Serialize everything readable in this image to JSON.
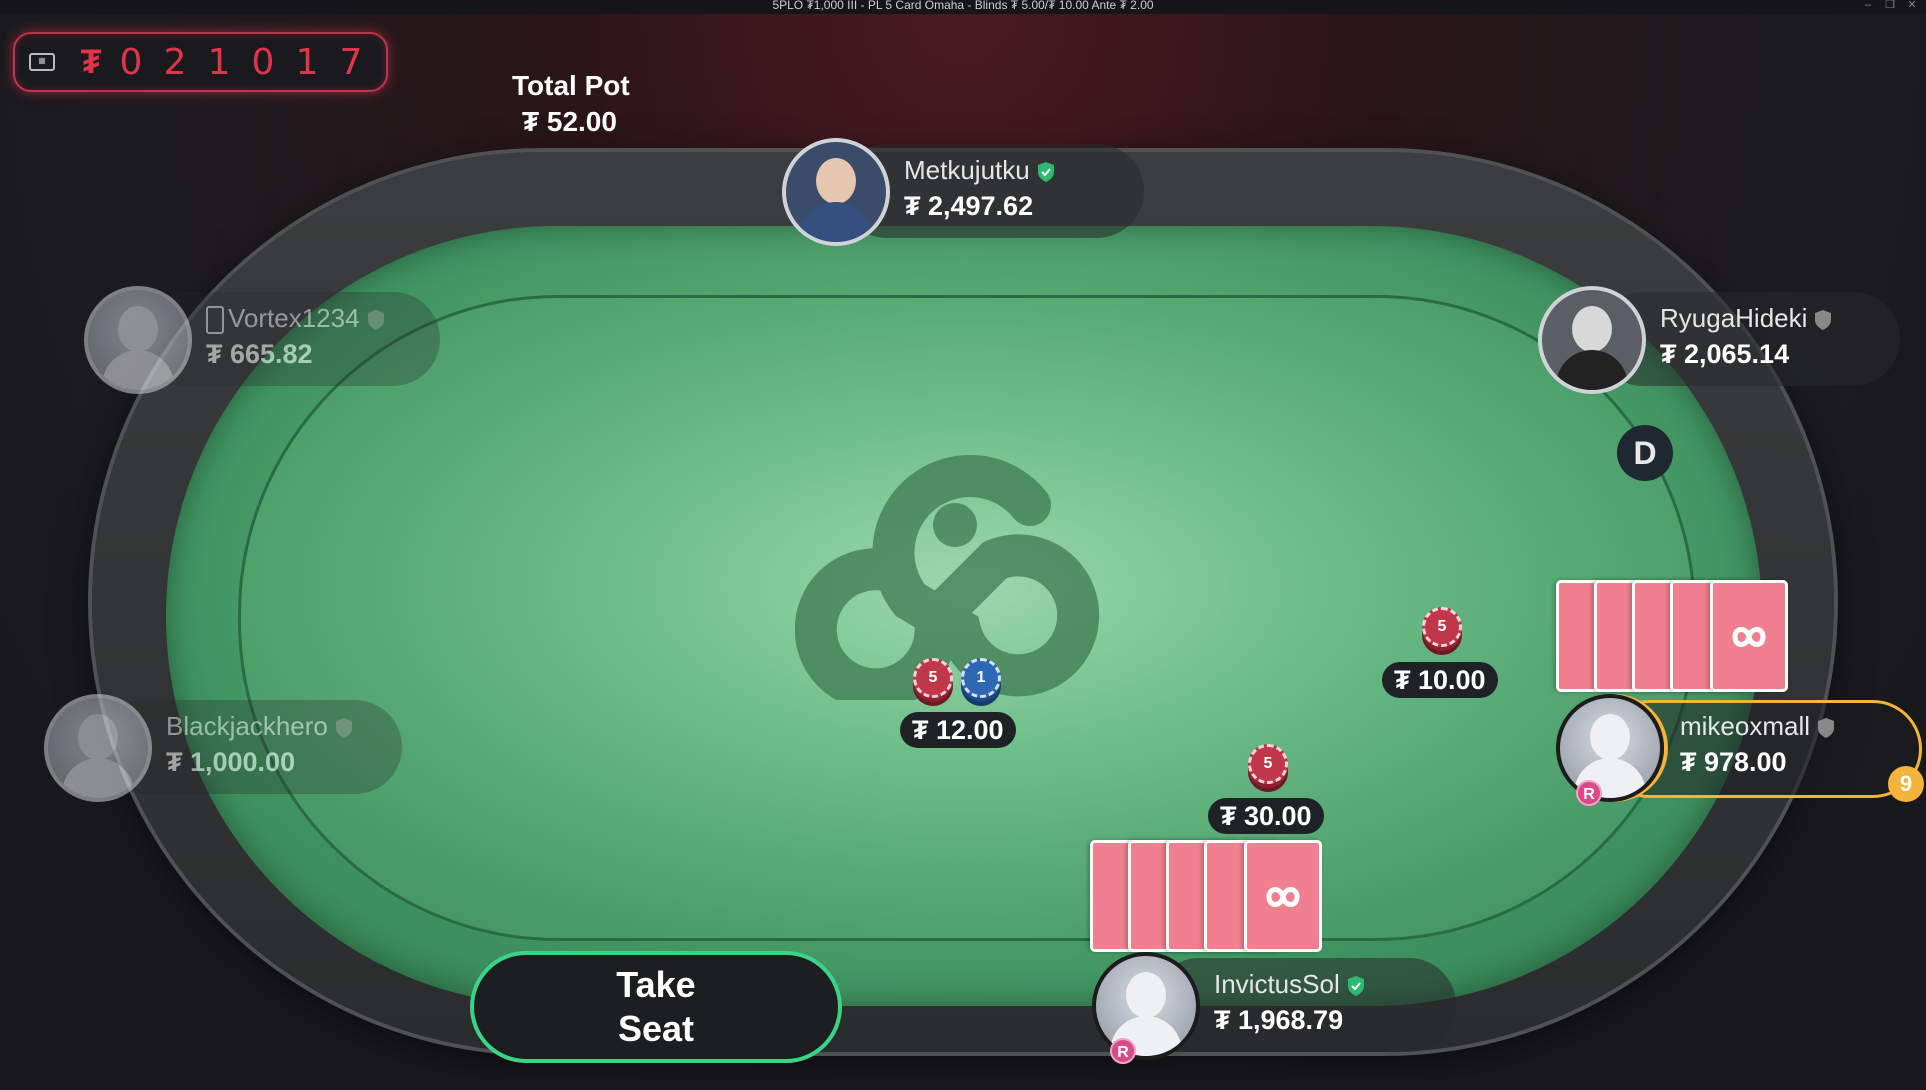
{
  "window": {
    "title": "5PLO ₮1,000 III - PL 5 Card Omaha - Blinds ₮ 5.00/₮ 10.00 Ante ₮ 2.00"
  },
  "jackpot": {
    "currency": "₮",
    "digits": [
      "0",
      "2",
      "1",
      "0",
      "1",
      "7"
    ]
  },
  "pot": {
    "label": "Total Pot",
    "amount": "₮ 52.00"
  },
  "players": {
    "top": {
      "name": "Metkujutku",
      "stack": "₮ 2,497.62",
      "verified": true
    },
    "left_upper": {
      "name": "Vortex1234",
      "stack": "₮ 665.82",
      "verified": false
    },
    "right_upper": {
      "name": "RyugaHideki",
      "stack": "₮ 2,065.14",
      "verified": false
    },
    "left_lower": {
      "name": "Blackjackhero",
      "stack": "₮ 1,000.00",
      "verified": false
    },
    "right_lower": {
      "name": "mikeoxmall",
      "stack": "₮ 978.00",
      "verified": false,
      "badge": "R",
      "timer": "9"
    },
    "bottom": {
      "name": "InvictusSol",
      "stack": "₮ 1,968.79",
      "verified": true,
      "badge": "R"
    }
  },
  "bets": {
    "center": {
      "amount": "₮ 12.00",
      "chips": [
        "5",
        "1"
      ]
    },
    "right": {
      "amount": "₮ 10.00",
      "chips": [
        "5"
      ]
    },
    "bottom": {
      "amount": "₮ 30.00",
      "chips": [
        "5"
      ]
    }
  },
  "dealer_button": "D",
  "take_seat": {
    "line1": "Take",
    "line2": "Seat"
  },
  "colors": {
    "accent_green": "#3bd387",
    "jackpot_red": "#e0344a",
    "card_back": "#f08090",
    "active_ring": "#f4b33a"
  }
}
